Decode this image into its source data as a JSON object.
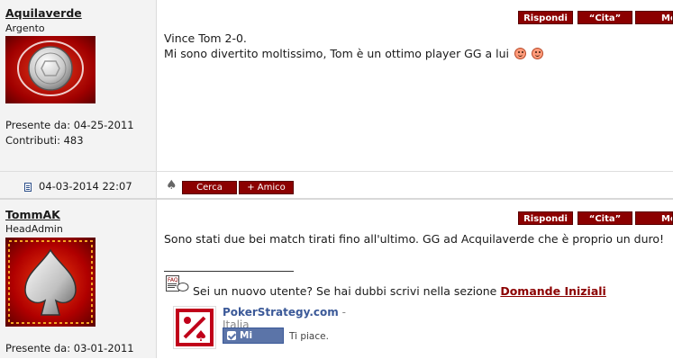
{
  "posts": [
    {
      "username": "Aquilaverde",
      "rank": "Argento",
      "joined": "Presente da: 04-25-2011",
      "contributions": "Contributi: 483",
      "buttons": {
        "reply": "Rispondi",
        "quote": "“Cita”",
        "more": "Mo"
      },
      "lines": [
        "Vince Tom 2-0.",
        "Mi sono divertito moltissimo, Tom è un ottimo player GG a lui"
      ],
      "footer_date": "04-03-2014 22:07",
      "footer_buttons": {
        "search": "Cerca",
        "friend": "+ Amico"
      }
    },
    {
      "username": "TommAK",
      "rank": "HeadAdmin",
      "joined": "Presente da: 03-01-2011",
      "buttons": {
        "reply": "Rispondi",
        "quote": "“Cita”",
        "more": "Mo"
      },
      "lines": [
        "Sono stati due bei match tirati fino all'ultimo. GG ad Acquilaverde che è proprio un duro!"
      ],
      "signature": {
        "faq_label": "FAQ",
        "text": "Sei un nuovo utente? Se hai dubbi scrivi nella sezione ",
        "link": "Domande Iniziali"
      },
      "facebook": {
        "page_name": "PokerStrategy.com",
        "page_sub": " - Italia",
        "like_label": "Mi piace",
        "ti_piace": "Ti piace."
      }
    }
  ],
  "colors": {
    "button_red": "#8b0000",
    "panel_gray": "#f3f3f3",
    "link_red": "#8b0000",
    "fb_blue": "#3b5998"
  },
  "icons": [
    "medal-silver-avatar",
    "spade-avatar",
    "document-icon",
    "spade-icon",
    "faq-icon",
    "smiley-icon",
    "like-check-icon",
    "pokerstrategy-logo"
  ]
}
